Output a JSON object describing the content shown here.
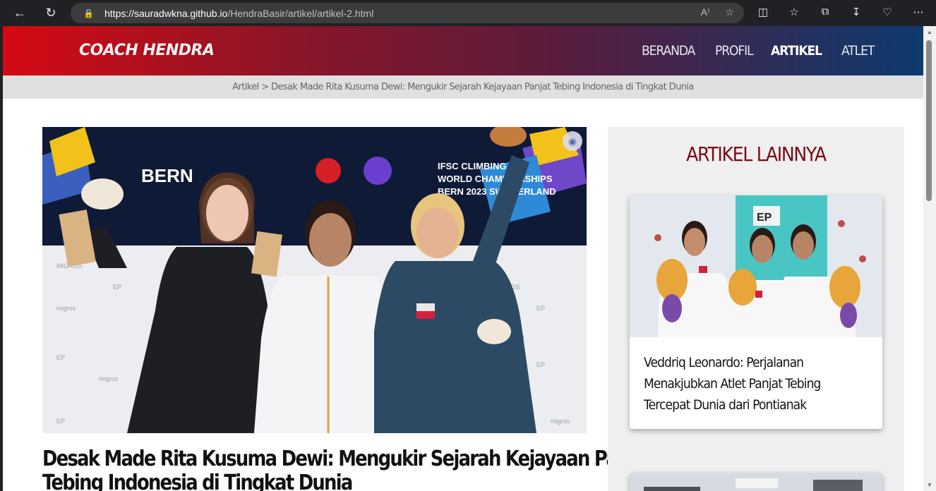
{
  "browser": {
    "url_domain": "https://sauradwkna.github.io",
    "url_path": "/HendraBasir/artikel/artikel-2.html"
  },
  "site": {
    "logo": "COACH HENDRA",
    "menu": [
      {
        "label": "BERANDA",
        "active": false
      },
      {
        "label": "PROFIL",
        "active": false
      },
      {
        "label": "ARTIKEL",
        "active": true
      },
      {
        "label": "ATLET",
        "active": false
      }
    ]
  },
  "breadcrumb": {
    "text": "Artikel > Desak Made Rita Kusuma Dewi: Mengukir Sejarah Kejayaan Panjat Tebing Indonesia di Tingkat Dunia"
  },
  "article": {
    "title_line1": "Desak Made Rita Kusuma Dewi: Mengukir Sejarah Kejayaan Panjat",
    "title_line2": "Tebing Indonesia di Tingkat Dunia",
    "hero_banner_left": "BERN",
    "hero_banner_right": "IFSC CLIMBING WORLD CHAMPIONSHIPS BERN 2023 SWITZERLAND",
    "hero_sponsor": "MIGROS"
  },
  "sidebar": {
    "title": "ARTIKEL LAINNYA",
    "cards": [
      {
        "title": "Veddriq Leonardo: Perjalanan Menakjubkan Atlet Panjat Tebing Tercepat Dunia dari Pontianak"
      }
    ]
  }
}
